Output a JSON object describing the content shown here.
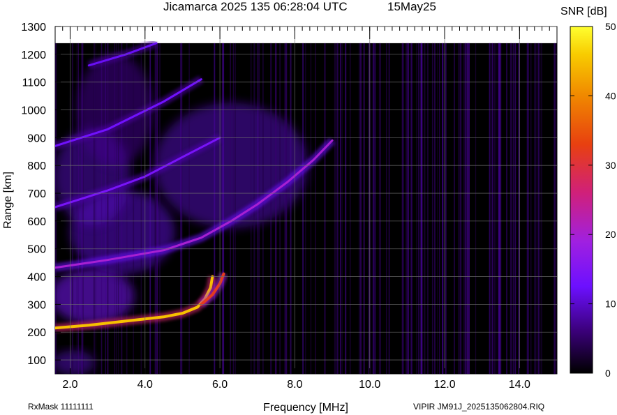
{
  "header": {
    "title": "Jicamarca 2025 135 06:28:04 UTC",
    "date": "15May25"
  },
  "footer": {
    "rxmask": "RxMask 11111111",
    "file": "VIPIR  JM91J_2025135062804.RIQ"
  },
  "colors": {
    "background": "#000000",
    "low": "#2a0050",
    "mid": "#8a18ff",
    "high": "#d81e60",
    "peak": "#ffee00",
    "grid": "#6f6f6f"
  },
  "chart_data": {
    "type": "heatmap",
    "title": "Jicamarca 2025 135 06:28:04 UTC",
    "xlabel": "Frequency [MHz]",
    "ylabel": "Range [km]",
    "xlim": [
      1.6,
      15.0
    ],
    "ylim": [
      50,
      1300
    ],
    "xticks": [
      2.0,
      4.0,
      6.0,
      8.0,
      10.0,
      12.0,
      14.0
    ],
    "xtick_labels": [
      "2.0",
      "4.0",
      "6.0",
      "8.0",
      "10.0",
      "12.0",
      "14.0"
    ],
    "yticks": [
      100,
      200,
      300,
      400,
      500,
      600,
      700,
      800,
      900,
      1000,
      1100,
      1200,
      1300
    ],
    "ytick_labels": [
      "100",
      "200",
      "300",
      "400",
      "500",
      "600",
      "700",
      "800",
      "900",
      "1000",
      "1100",
      "1200",
      "1300"
    ],
    "colorbar": {
      "label": "SNR [dB]",
      "range": [
        0,
        50
      ],
      "ticks": [
        0,
        10,
        20,
        30,
        40,
        50
      ],
      "tick_labels": [
        "0",
        "10",
        "20",
        "30",
        "40",
        "50"
      ]
    },
    "grid": true,
    "data_range_limit_km": 1240,
    "traces": [
      {
        "name_internal": "F-trace O",
        "points": [
          [
            1.6,
            215
          ],
          [
            2.5,
            225
          ],
          [
            3.5,
            240
          ],
          [
            4.5,
            255
          ],
          [
            5.0,
            268
          ],
          [
            5.4,
            290
          ],
          [
            5.6,
            320
          ],
          [
            5.75,
            360
          ],
          [
            5.8,
            400
          ]
        ],
        "snr": 45
      },
      {
        "name_internal": "F-trace X",
        "points": [
          [
            5.5,
            300
          ],
          [
            5.8,
            335
          ],
          [
            6.0,
            375
          ],
          [
            6.1,
            410
          ]
        ],
        "snr": 32
      },
      {
        "name_internal": "2F echo",
        "points": [
          [
            1.6,
            432
          ],
          [
            3.0,
            460
          ],
          [
            4.5,
            495
          ],
          [
            5.5,
            540
          ],
          [
            6.3,
            600
          ],
          [
            7.0,
            660
          ],
          [
            7.8,
            740
          ],
          [
            8.5,
            820
          ],
          [
            9.0,
            890
          ]
        ],
        "snr": 20
      },
      {
        "name_internal": "3F echo",
        "points": [
          [
            1.6,
            650
          ],
          [
            3.0,
            710
          ],
          [
            4.0,
            760
          ],
          [
            5.0,
            830
          ],
          [
            6.0,
            900
          ]
        ],
        "snr": 14
      },
      {
        "name_internal": "4F echo",
        "points": [
          [
            1.6,
            870
          ],
          [
            3.0,
            930
          ],
          [
            4.5,
            1030
          ],
          [
            5.5,
            1110
          ]
        ],
        "snr": 13
      },
      {
        "name_internal": "5F echo",
        "points": [
          [
            2.5,
            1160
          ],
          [
            3.5,
            1200
          ],
          [
            4.3,
            1240
          ]
        ],
        "snr": 12
      }
    ]
  }
}
